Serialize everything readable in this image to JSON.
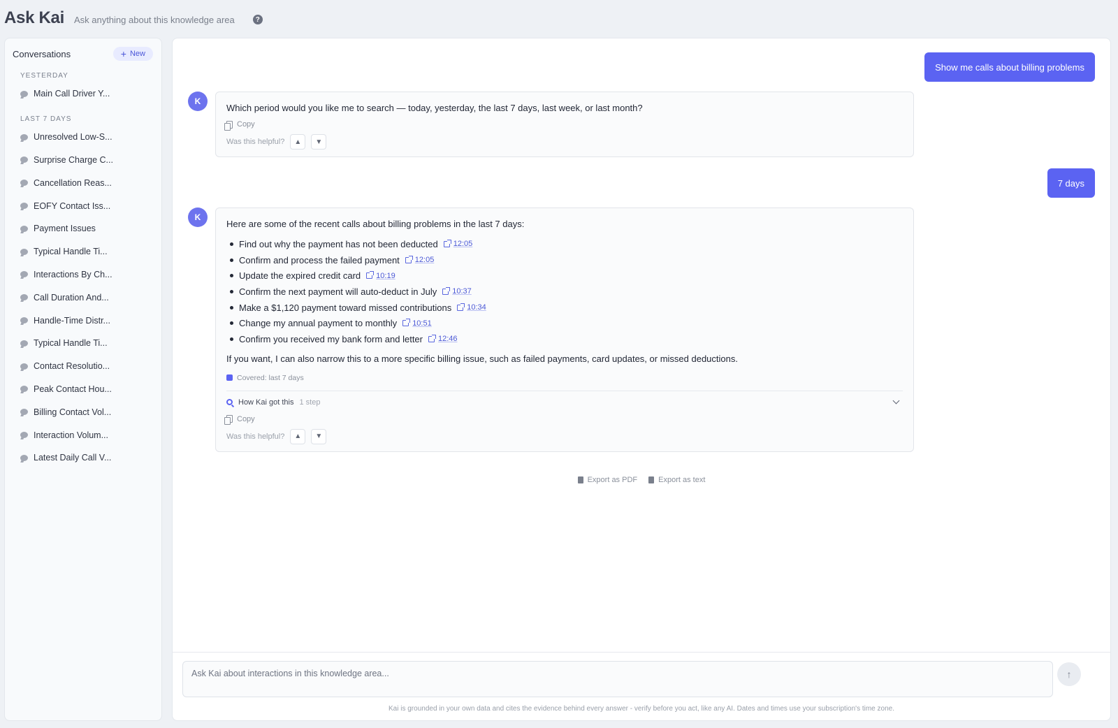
{
  "header": {
    "title": "Ask Kai",
    "subtitle": "Ask anything about this knowledge area",
    "help_icon": "?"
  },
  "sidebar": {
    "title": "Conversations",
    "new_label": "New",
    "groups": [
      {
        "label": "YESTERDAY",
        "items": [
          "Main Call Driver Y..."
        ]
      },
      {
        "label": "LAST 7 DAYS",
        "items": [
          "Unresolved Low-S...",
          "Surprise Charge C...",
          "Cancellation Reas...",
          "EOFY Contact Iss...",
          "Payment Issues",
          "Typical Handle Ti...",
          "Interactions By Ch...",
          "Call Duration And...",
          "Handle-Time Distr...",
          "Typical Handle Ti...",
          "Contact Resolutio...",
          "Peak Contact Hou...",
          "Billing Contact Vol...",
          "Interaction Volum...",
          "Latest Daily Call V..."
        ]
      }
    ]
  },
  "chat": {
    "avatar_letter": "K",
    "msg1_user": "Show me calls about billing problems",
    "msg1_bot": "Which period would you like me to search — today, yesterday, the last 7 days, last week, or last month?",
    "msg2_user": "7 days",
    "msg2_bot_intro": "Here are some of the recent calls about billing problems in the last 7 days:",
    "msg2_bullets": [
      {
        "text": "Find out why the payment has not been deducted",
        "time": "12:05"
      },
      {
        "text": "Confirm and process the failed payment",
        "time": "12:05"
      },
      {
        "text": "Update the expired credit card",
        "time": "10:19"
      },
      {
        "text": "Confirm the next payment will auto-deduct in July",
        "time": "10:37"
      },
      {
        "text": "Make a $1,120 payment toward missed contributions",
        "time": "10:34"
      },
      {
        "text": "Change my annual payment to monthly",
        "time": "10:51"
      },
      {
        "text": "Confirm you received my bank form and letter",
        "time": "12:46"
      }
    ],
    "msg2_bot_outro": "If you want, I can also narrow this to a more specific billing issue, such as failed payments, card updates, or missed deductions.",
    "covered": "Covered: last 7 days",
    "how_label": "How Kai got this",
    "how_steps": "1 step",
    "copy_label": "Copy",
    "helpful_label": "Was this helpful?"
  },
  "exports": {
    "pdf": "Export as PDF",
    "text": "Export as text"
  },
  "composer": {
    "placeholder": "Ask Kai about interactions in this knowledge area...",
    "disclaimer": "Kai is grounded in your own data and cites the evidence behind every answer - verify before you act, like any AI. Dates and times use your subscription's time zone."
  },
  "colors": {
    "accent": "#5b63f2",
    "avatar": "#6d73ee",
    "background": "#eef1f5"
  }
}
